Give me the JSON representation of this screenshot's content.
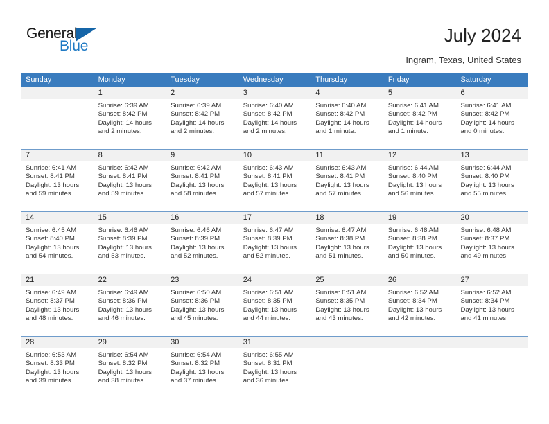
{
  "brand": {
    "name_part1": "General",
    "name_part2": "Blue",
    "triangle_color": "#1565a8",
    "blue_text_color": "#1f7ac4"
  },
  "header": {
    "title": "July 2024",
    "location": "Ingram, Texas, United States",
    "header_bg_color": "#3a7cbe",
    "daynum_bg_color": "#f1f1f1"
  },
  "weekday_names": [
    "Sunday",
    "Monday",
    "Tuesday",
    "Wednesday",
    "Thursday",
    "Friday",
    "Saturday"
  ],
  "weeks": [
    [
      {
        "day": "",
        "sunrise": "",
        "sunset": "",
        "daylight_line1": "",
        "daylight_line2": ""
      },
      {
        "day": "1",
        "sunrise": "Sunrise: 6:39 AM",
        "sunset": "Sunset: 8:42 PM",
        "daylight_line1": "Daylight: 14 hours",
        "daylight_line2": "and 2 minutes."
      },
      {
        "day": "2",
        "sunrise": "Sunrise: 6:39 AM",
        "sunset": "Sunset: 8:42 PM",
        "daylight_line1": "Daylight: 14 hours",
        "daylight_line2": "and 2 minutes."
      },
      {
        "day": "3",
        "sunrise": "Sunrise: 6:40 AM",
        "sunset": "Sunset: 8:42 PM",
        "daylight_line1": "Daylight: 14 hours",
        "daylight_line2": "and 2 minutes."
      },
      {
        "day": "4",
        "sunrise": "Sunrise: 6:40 AM",
        "sunset": "Sunset: 8:42 PM",
        "daylight_line1": "Daylight: 14 hours",
        "daylight_line2": "and 1 minute."
      },
      {
        "day": "5",
        "sunrise": "Sunrise: 6:41 AM",
        "sunset": "Sunset: 8:42 PM",
        "daylight_line1": "Daylight: 14 hours",
        "daylight_line2": "and 1 minute."
      },
      {
        "day": "6",
        "sunrise": "Sunrise: 6:41 AM",
        "sunset": "Sunset: 8:42 PM",
        "daylight_line1": "Daylight: 14 hours",
        "daylight_line2": "and 0 minutes."
      }
    ],
    [
      {
        "day": "7",
        "sunrise": "Sunrise: 6:41 AM",
        "sunset": "Sunset: 8:41 PM",
        "daylight_line1": "Daylight: 13 hours",
        "daylight_line2": "and 59 minutes."
      },
      {
        "day": "8",
        "sunrise": "Sunrise: 6:42 AM",
        "sunset": "Sunset: 8:41 PM",
        "daylight_line1": "Daylight: 13 hours",
        "daylight_line2": "and 59 minutes."
      },
      {
        "day": "9",
        "sunrise": "Sunrise: 6:42 AM",
        "sunset": "Sunset: 8:41 PM",
        "daylight_line1": "Daylight: 13 hours",
        "daylight_line2": "and 58 minutes."
      },
      {
        "day": "10",
        "sunrise": "Sunrise: 6:43 AM",
        "sunset": "Sunset: 8:41 PM",
        "daylight_line1": "Daylight: 13 hours",
        "daylight_line2": "and 57 minutes."
      },
      {
        "day": "11",
        "sunrise": "Sunrise: 6:43 AM",
        "sunset": "Sunset: 8:41 PM",
        "daylight_line1": "Daylight: 13 hours",
        "daylight_line2": "and 57 minutes."
      },
      {
        "day": "12",
        "sunrise": "Sunrise: 6:44 AM",
        "sunset": "Sunset: 8:40 PM",
        "daylight_line1": "Daylight: 13 hours",
        "daylight_line2": "and 56 minutes."
      },
      {
        "day": "13",
        "sunrise": "Sunrise: 6:44 AM",
        "sunset": "Sunset: 8:40 PM",
        "daylight_line1": "Daylight: 13 hours",
        "daylight_line2": "and 55 minutes."
      }
    ],
    [
      {
        "day": "14",
        "sunrise": "Sunrise: 6:45 AM",
        "sunset": "Sunset: 8:40 PM",
        "daylight_line1": "Daylight: 13 hours",
        "daylight_line2": "and 54 minutes."
      },
      {
        "day": "15",
        "sunrise": "Sunrise: 6:46 AM",
        "sunset": "Sunset: 8:39 PM",
        "daylight_line1": "Daylight: 13 hours",
        "daylight_line2": "and 53 minutes."
      },
      {
        "day": "16",
        "sunrise": "Sunrise: 6:46 AM",
        "sunset": "Sunset: 8:39 PM",
        "daylight_line1": "Daylight: 13 hours",
        "daylight_line2": "and 52 minutes."
      },
      {
        "day": "17",
        "sunrise": "Sunrise: 6:47 AM",
        "sunset": "Sunset: 8:39 PM",
        "daylight_line1": "Daylight: 13 hours",
        "daylight_line2": "and 52 minutes."
      },
      {
        "day": "18",
        "sunrise": "Sunrise: 6:47 AM",
        "sunset": "Sunset: 8:38 PM",
        "daylight_line1": "Daylight: 13 hours",
        "daylight_line2": "and 51 minutes."
      },
      {
        "day": "19",
        "sunrise": "Sunrise: 6:48 AM",
        "sunset": "Sunset: 8:38 PM",
        "daylight_line1": "Daylight: 13 hours",
        "daylight_line2": "and 50 minutes."
      },
      {
        "day": "20",
        "sunrise": "Sunrise: 6:48 AM",
        "sunset": "Sunset: 8:37 PM",
        "daylight_line1": "Daylight: 13 hours",
        "daylight_line2": "and 49 minutes."
      }
    ],
    [
      {
        "day": "21",
        "sunrise": "Sunrise: 6:49 AM",
        "sunset": "Sunset: 8:37 PM",
        "daylight_line1": "Daylight: 13 hours",
        "daylight_line2": "and 48 minutes."
      },
      {
        "day": "22",
        "sunrise": "Sunrise: 6:49 AM",
        "sunset": "Sunset: 8:36 PM",
        "daylight_line1": "Daylight: 13 hours",
        "daylight_line2": "and 46 minutes."
      },
      {
        "day": "23",
        "sunrise": "Sunrise: 6:50 AM",
        "sunset": "Sunset: 8:36 PM",
        "daylight_line1": "Daylight: 13 hours",
        "daylight_line2": "and 45 minutes."
      },
      {
        "day": "24",
        "sunrise": "Sunrise: 6:51 AM",
        "sunset": "Sunset: 8:35 PM",
        "daylight_line1": "Daylight: 13 hours",
        "daylight_line2": "and 44 minutes."
      },
      {
        "day": "25",
        "sunrise": "Sunrise: 6:51 AM",
        "sunset": "Sunset: 8:35 PM",
        "daylight_line1": "Daylight: 13 hours",
        "daylight_line2": "and 43 minutes."
      },
      {
        "day": "26",
        "sunrise": "Sunrise: 6:52 AM",
        "sunset": "Sunset: 8:34 PM",
        "daylight_line1": "Daylight: 13 hours",
        "daylight_line2": "and 42 minutes."
      },
      {
        "day": "27",
        "sunrise": "Sunrise: 6:52 AM",
        "sunset": "Sunset: 8:34 PM",
        "daylight_line1": "Daylight: 13 hours",
        "daylight_line2": "and 41 minutes."
      }
    ],
    [
      {
        "day": "28",
        "sunrise": "Sunrise: 6:53 AM",
        "sunset": "Sunset: 8:33 PM",
        "daylight_line1": "Daylight: 13 hours",
        "daylight_line2": "and 39 minutes."
      },
      {
        "day": "29",
        "sunrise": "Sunrise: 6:54 AM",
        "sunset": "Sunset: 8:32 PM",
        "daylight_line1": "Daylight: 13 hours",
        "daylight_line2": "and 38 minutes."
      },
      {
        "day": "30",
        "sunrise": "Sunrise: 6:54 AM",
        "sunset": "Sunset: 8:32 PM",
        "daylight_line1": "Daylight: 13 hours",
        "daylight_line2": "and 37 minutes."
      },
      {
        "day": "31",
        "sunrise": "Sunrise: 6:55 AM",
        "sunset": "Sunset: 8:31 PM",
        "daylight_line1": "Daylight: 13 hours",
        "daylight_line2": "and 36 minutes."
      },
      {
        "day": "",
        "sunrise": "",
        "sunset": "",
        "daylight_line1": "",
        "daylight_line2": ""
      },
      {
        "day": "",
        "sunrise": "",
        "sunset": "",
        "daylight_line1": "",
        "daylight_line2": ""
      },
      {
        "day": "",
        "sunrise": "",
        "sunset": "",
        "daylight_line1": "",
        "daylight_line2": ""
      }
    ]
  ]
}
